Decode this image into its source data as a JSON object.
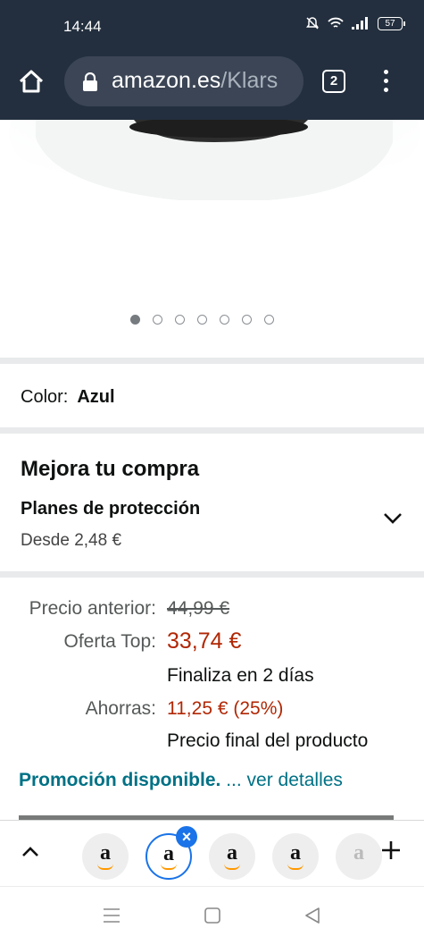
{
  "status_bar": {
    "time": "14:44",
    "battery": "57"
  },
  "browser": {
    "url_host": "amazon.es",
    "url_path": "/Klars",
    "tab_count": "2"
  },
  "gallery": {
    "image_count": 7,
    "active_index": 0
  },
  "color": {
    "label": "Color:",
    "value": "Azul"
  },
  "upgrade": {
    "title": "Mejora tu compra",
    "plan_title": "Planes de protección",
    "plan_price": "Desde 2,48 €"
  },
  "pricing": {
    "previous_label": "Precio anterior:",
    "previous_value": "44,99 €",
    "deal_label": "Oferta Top:",
    "deal_value": "33,74 €",
    "deal_ends": "Finaliza en 2 días",
    "savings_label": "Ahorras:",
    "savings_value": "11,25 € (25%)",
    "final_note": "Precio final del producto"
  },
  "promo": {
    "title": "Promoción disponible.",
    "link": "... ver detalles"
  },
  "tab_strip": {
    "tab_letter": "a"
  },
  "colors": {
    "chrome": "#232f3e",
    "price_red": "#b12704",
    "link_teal": "#007185",
    "tab_blue": "#1a73e8"
  }
}
